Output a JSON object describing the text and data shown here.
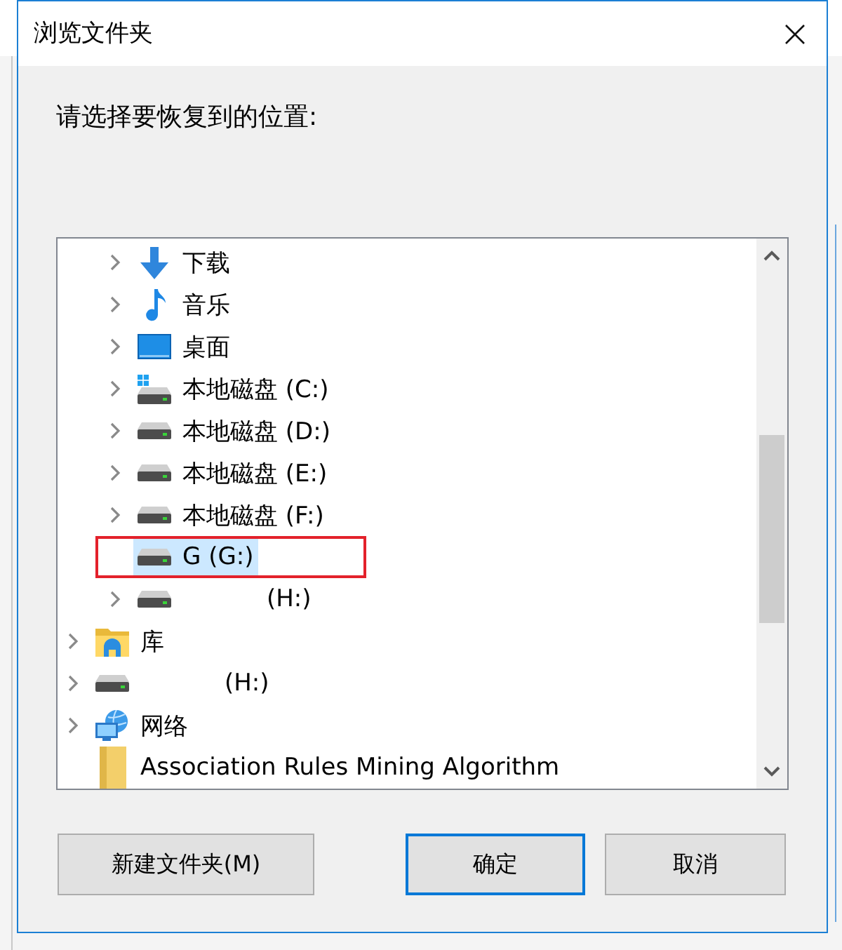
{
  "window": {
    "title": "浏览文件夹"
  },
  "prompt": "请选择要恢复到的位置:",
  "tree": {
    "items": [
      {
        "children": [
          {
            "label": "下载",
            "kind": "download",
            "expandable": true,
            "selected": false,
            "marked": false,
            "redacted": false
          },
          {
            "label": "音乐",
            "kind": "music",
            "expandable": true,
            "selected": false,
            "marked": false,
            "redacted": false
          },
          {
            "label": "桌面",
            "kind": "desktop",
            "expandable": true,
            "selected": false,
            "marked": false,
            "redacted": false
          },
          {
            "label": "本地磁盘 (C:)",
            "kind": "system",
            "expandable": true,
            "selected": false,
            "marked": false,
            "redacted": false
          },
          {
            "label": "本地磁盘 (D:)",
            "kind": "drive",
            "expandable": true,
            "selected": false,
            "marked": false,
            "redacted": false
          },
          {
            "label": "本地磁盘 (E:)",
            "kind": "drive",
            "expandable": true,
            "selected": false,
            "marked": false,
            "redacted": false
          },
          {
            "label": "本地磁盘 (F:)",
            "kind": "drive",
            "expandable": true,
            "selected": false,
            "marked": false,
            "redacted": false
          },
          {
            "label": "G (G:)",
            "kind": "drive",
            "expandable": false,
            "selected": true,
            "marked": true,
            "redacted": false
          },
          {
            "label": "(H:)",
            "kind": "drive",
            "expandable": true,
            "selected": false,
            "marked": false,
            "redacted": true
          }
        ]
      },
      {
        "label": "库",
        "kind": "library",
        "expandable": true,
        "selected": false,
        "marked": false,
        "redacted": false
      },
      {
        "label": "(H:)",
        "kind": "drive",
        "expandable": true,
        "selected": false,
        "marked": false,
        "redacted": true
      },
      {
        "label": "网络",
        "kind": "network",
        "expandable": true,
        "selected": false,
        "marked": false,
        "redacted": false
      },
      {
        "label": "Association Rules Mining Algorithm",
        "kind": "folder",
        "expandable": false,
        "selected": false,
        "marked": false,
        "redacted": false
      }
    ]
  },
  "buttons": [
    {
      "label": "新建文件夹(M)",
      "default": false
    },
    {
      "label": "确定",
      "default": true
    },
    {
      "label": "取消",
      "default": false
    }
  ]
}
